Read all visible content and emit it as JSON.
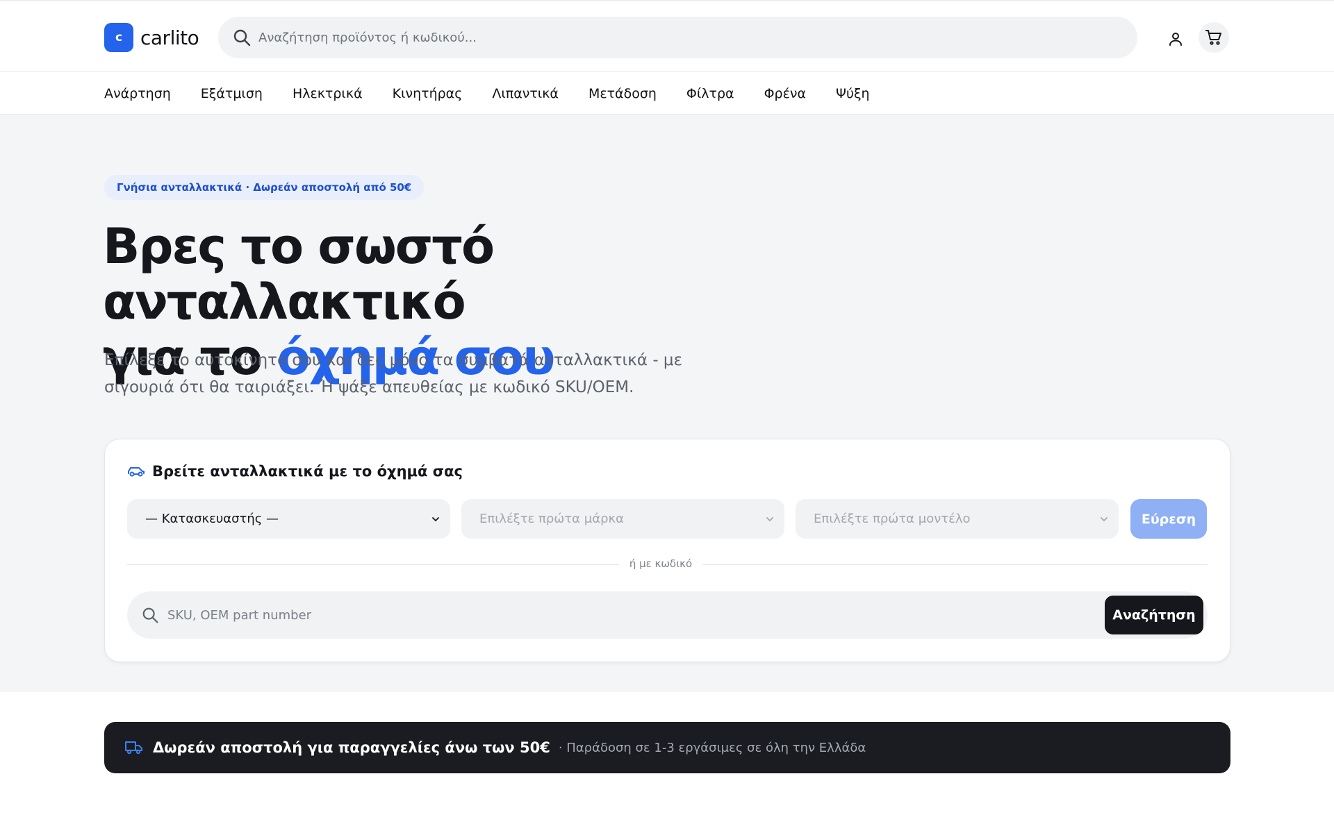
{
  "header": {
    "logo_letter": "c",
    "brand": "carlito",
    "search_placeholder": "Αναζήτηση προϊόντος ή κωδικού...",
    "icons": {
      "search": "search-icon",
      "user": "user-icon",
      "cart": "cart-icon"
    }
  },
  "categories": [
    "Ανάρτηση",
    "Εξάτμιση",
    "Ηλεκτρικά",
    "Κινητήρας",
    "Λιπαντικά",
    "Μετάδοση",
    "Φίλτρα",
    "Φρένα",
    "Ψύξη"
  ],
  "hero": {
    "badge": "Γνήσια ανταλλακτικά · Δωρεάν αποστολή από 50€",
    "headline_line1": "Βρες το σωστό ανταλλακτικό",
    "headline_line2_prefix": "για το ",
    "headline_line2_accent": "όχημά σου",
    "subtext": "Επίλεξε το αυτοκίνητο σου και δες μόνο τα συμβατά ανταλλακτικά - με σιγουριά ότι θα ταιριάξει. Ή ψάξε απευθείας με κωδικό SKU/OEM."
  },
  "finder": {
    "title": "Βρείτε ανταλλακτικά με το όχημά σας",
    "manufacturer_select": "— Κατασκευαστής —",
    "model_select": "Επιλέξτε πρώτα μάρκα",
    "engine_select": "Επιλέξτε πρώτα μοντέλο",
    "find_button": "Εύρεση",
    "divider_label": "ή με κωδικό",
    "sku_placeholder": "SKU, OEM part number",
    "sku_button": "Αναζήτηση"
  },
  "shipping": {
    "headline": "Δωρεάν αποστολή για παραγγελίες άνω των 50€",
    "detail": "· Παράδοση σε 1-3 εργάσιμες σε όλη την Ελλάδα"
  },
  "colors": {
    "accent": "#2463eb",
    "badge_bg": "#e8eefc",
    "hero_bg": "#f4f5f7",
    "dark": "#1a1c21",
    "disabled_button": "#8fb0f4"
  }
}
